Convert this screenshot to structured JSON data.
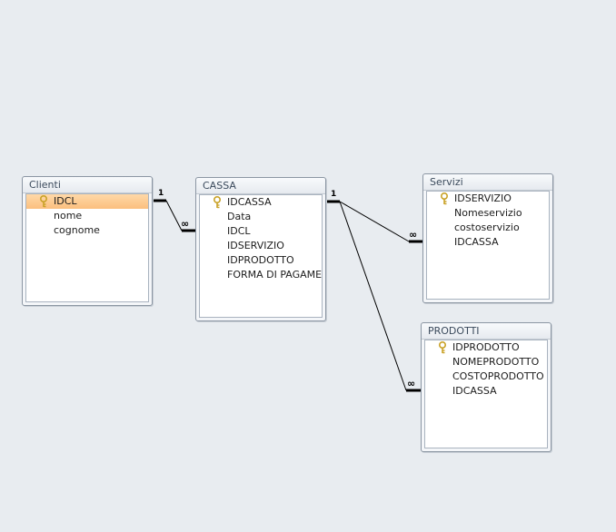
{
  "tables": {
    "clienti": {
      "title": "Clienti",
      "fields": [
        "IDCL",
        "nome",
        "cognome"
      ]
    },
    "cassa": {
      "title": "CASSA",
      "fields": [
        "IDCASSA",
        "Data",
        "IDCL",
        "IDSERVIZIO",
        "IDPRODOTTO",
        "FORMA DI PAGAMENTO"
      ]
    },
    "servizi": {
      "title": "Servizi",
      "fields": [
        "IDSERVIZIO",
        "Nomeservizio",
        "costoservizio",
        "IDCASSA"
      ]
    },
    "prodotti": {
      "title": "PRODOTTI",
      "fields": [
        "IDPRODOTTO",
        "NOMEPRODOTTO",
        "COSTOPRODOTTO",
        "IDCASSA"
      ]
    }
  },
  "relationships": {
    "one_label": "1",
    "many_label": "∞"
  },
  "colors": {
    "background": "#e8ecf0",
    "selected_field": "#fbbf7e",
    "key_icon": "#c9a227"
  },
  "icons": {
    "primary_key": "key-icon"
  }
}
